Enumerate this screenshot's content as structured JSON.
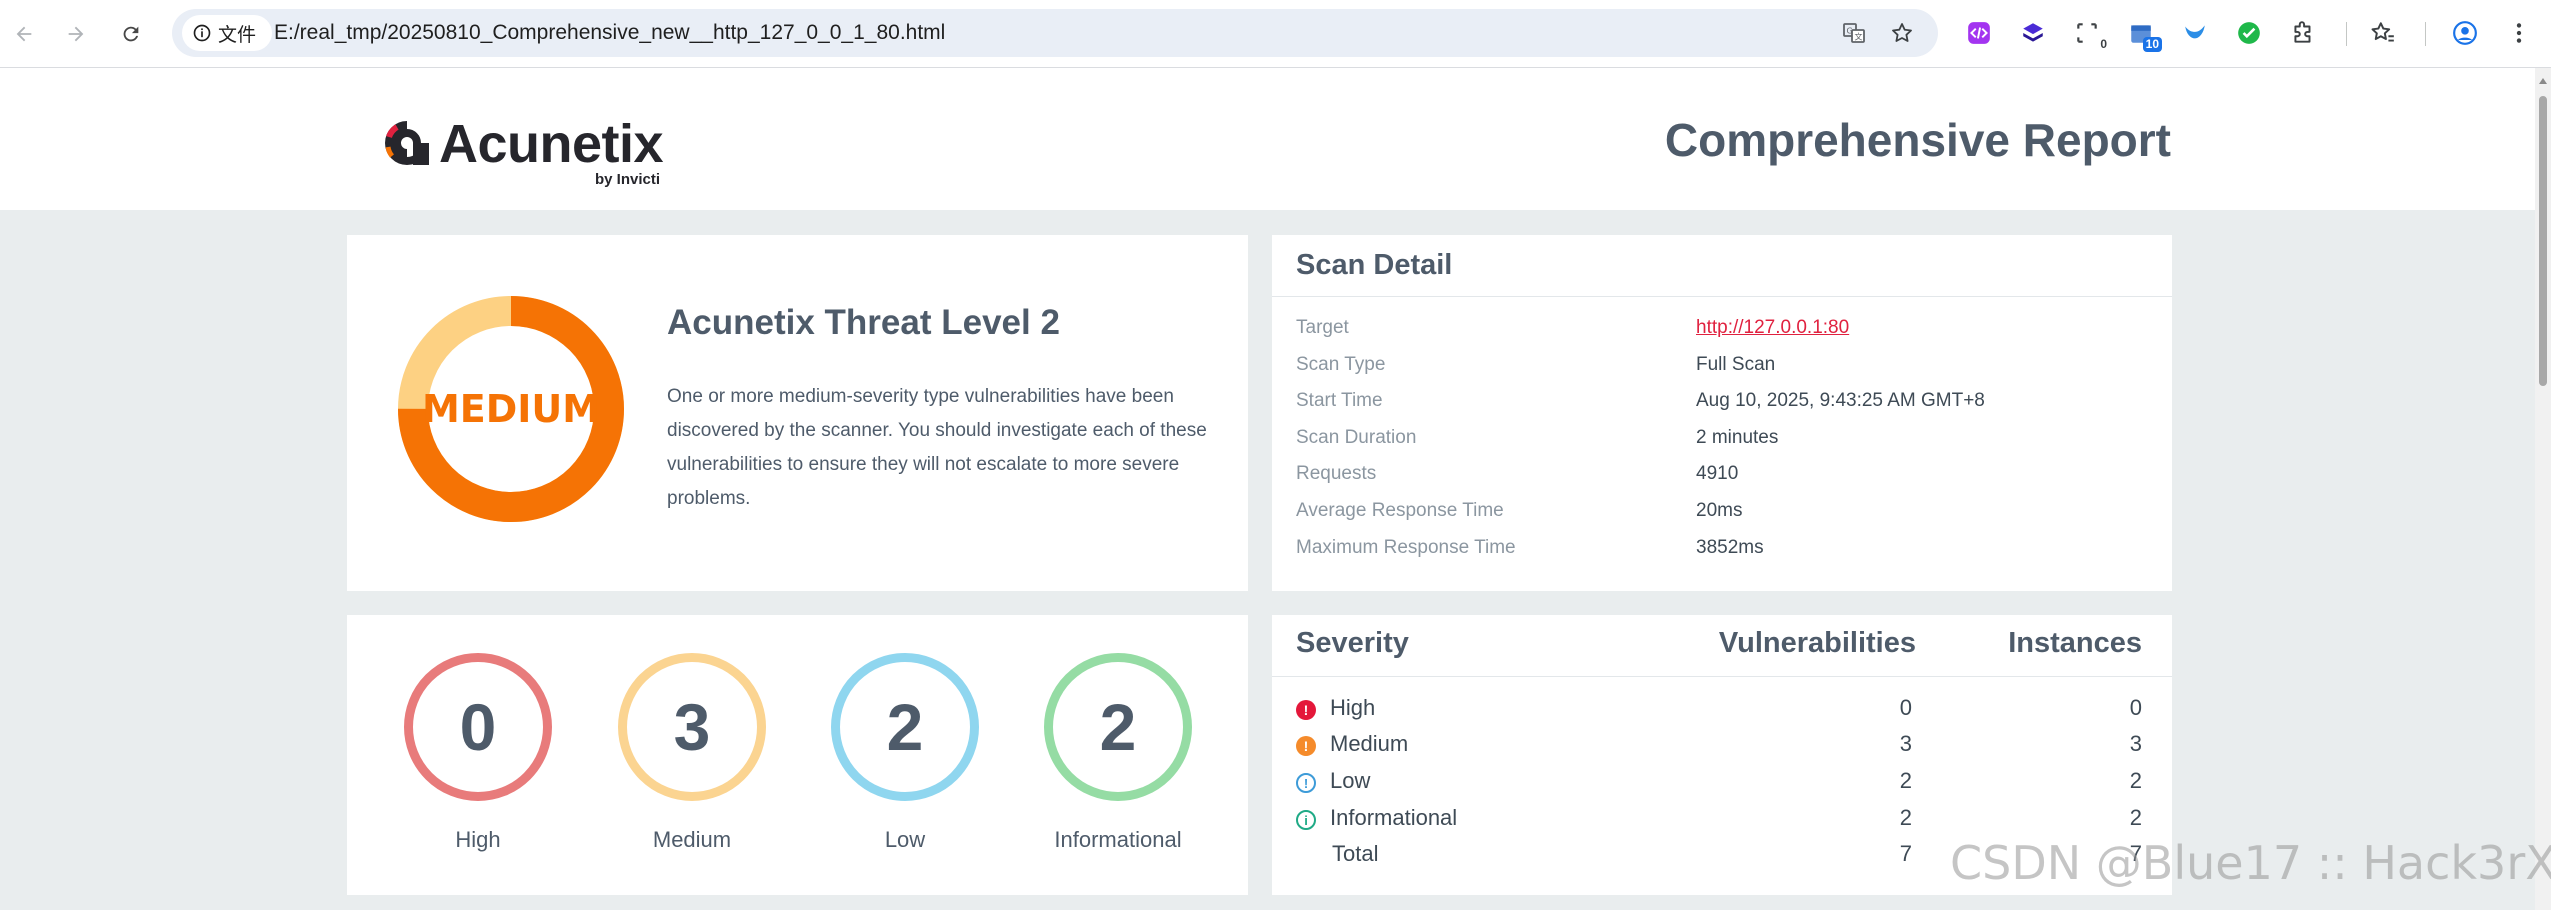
{
  "browser": {
    "info_chip_label": "文件",
    "url": "E:/real_tmp/20250810_Comprehensive_new__http_127_0_0_1_80.html",
    "ext_badge_1": "0",
    "ext_badge_2": "10"
  },
  "header": {
    "logo_word": "Acunetix",
    "logo_sub": "by Invicti",
    "title": "Comprehensive Report"
  },
  "threat": {
    "level_label": "MEDIUM",
    "title": "Acunetix Threat Level 2",
    "description": "One or more medium-severity type vulnerabilities have been discovered by the scanner. You should investigate each of these vulnerabilities to ensure they will not escalate to more severe problems.",
    "donut_fill_fraction": 0.75
  },
  "scan_detail": {
    "title": "Scan Detail",
    "rows": [
      {
        "key": "Target",
        "value": "http://127.0.0.1:80"
      },
      {
        "key": "Scan Type",
        "value": "Full Scan"
      },
      {
        "key": "Start Time",
        "value": "Aug 10, 2025, 9:43:25 AM GMT+8"
      },
      {
        "key": "Scan Duration",
        "value": "2 minutes"
      },
      {
        "key": "Requests",
        "value": "4910"
      },
      {
        "key": "Average Response Time",
        "value": "20ms"
      },
      {
        "key": "Maximum Response Time",
        "value": "3852ms"
      }
    ]
  },
  "counts": [
    {
      "value": "0",
      "label": "High",
      "color": "#e87b7b"
    },
    {
      "value": "3",
      "label": "Medium",
      "color": "#fbd491"
    },
    {
      "value": "2",
      "label": "Low",
      "color": "#8fd6ef"
    },
    {
      "value": "2",
      "label": "Informational",
      "color": "#95dca4"
    }
  ],
  "severity_table": {
    "col_severity": "Severity",
    "col_vulnerabilities": "Vulnerabilities",
    "col_instances": "Instances",
    "rows": [
      {
        "name": "High",
        "vulnerabilities": "0",
        "instances": "0",
        "icon": "exclamation-icon",
        "color": "#e4173a"
      },
      {
        "name": "Medium",
        "vulnerabilities": "3",
        "instances": "3",
        "icon": "exclamation-icon",
        "color": "#f58b2b"
      },
      {
        "name": "Low",
        "vulnerabilities": "2",
        "instances": "2",
        "icon": "exclamation-icon",
        "color": "#3d9bd8"
      },
      {
        "name": "Informational",
        "vulnerabilities": "2",
        "instances": "2",
        "icon": "info-icon",
        "color": "#1faa86"
      }
    ],
    "total_label": "Total",
    "total_vulnerabilities": "7",
    "total_instances": "7"
  },
  "watermark": "CSDN @Blue17 :: Hack3rX",
  "colors": {
    "accent_orange": "#f57305",
    "donut_light": "#fdd183",
    "text_dark": "#4e5b6a",
    "page_bg": "#e9edee"
  }
}
